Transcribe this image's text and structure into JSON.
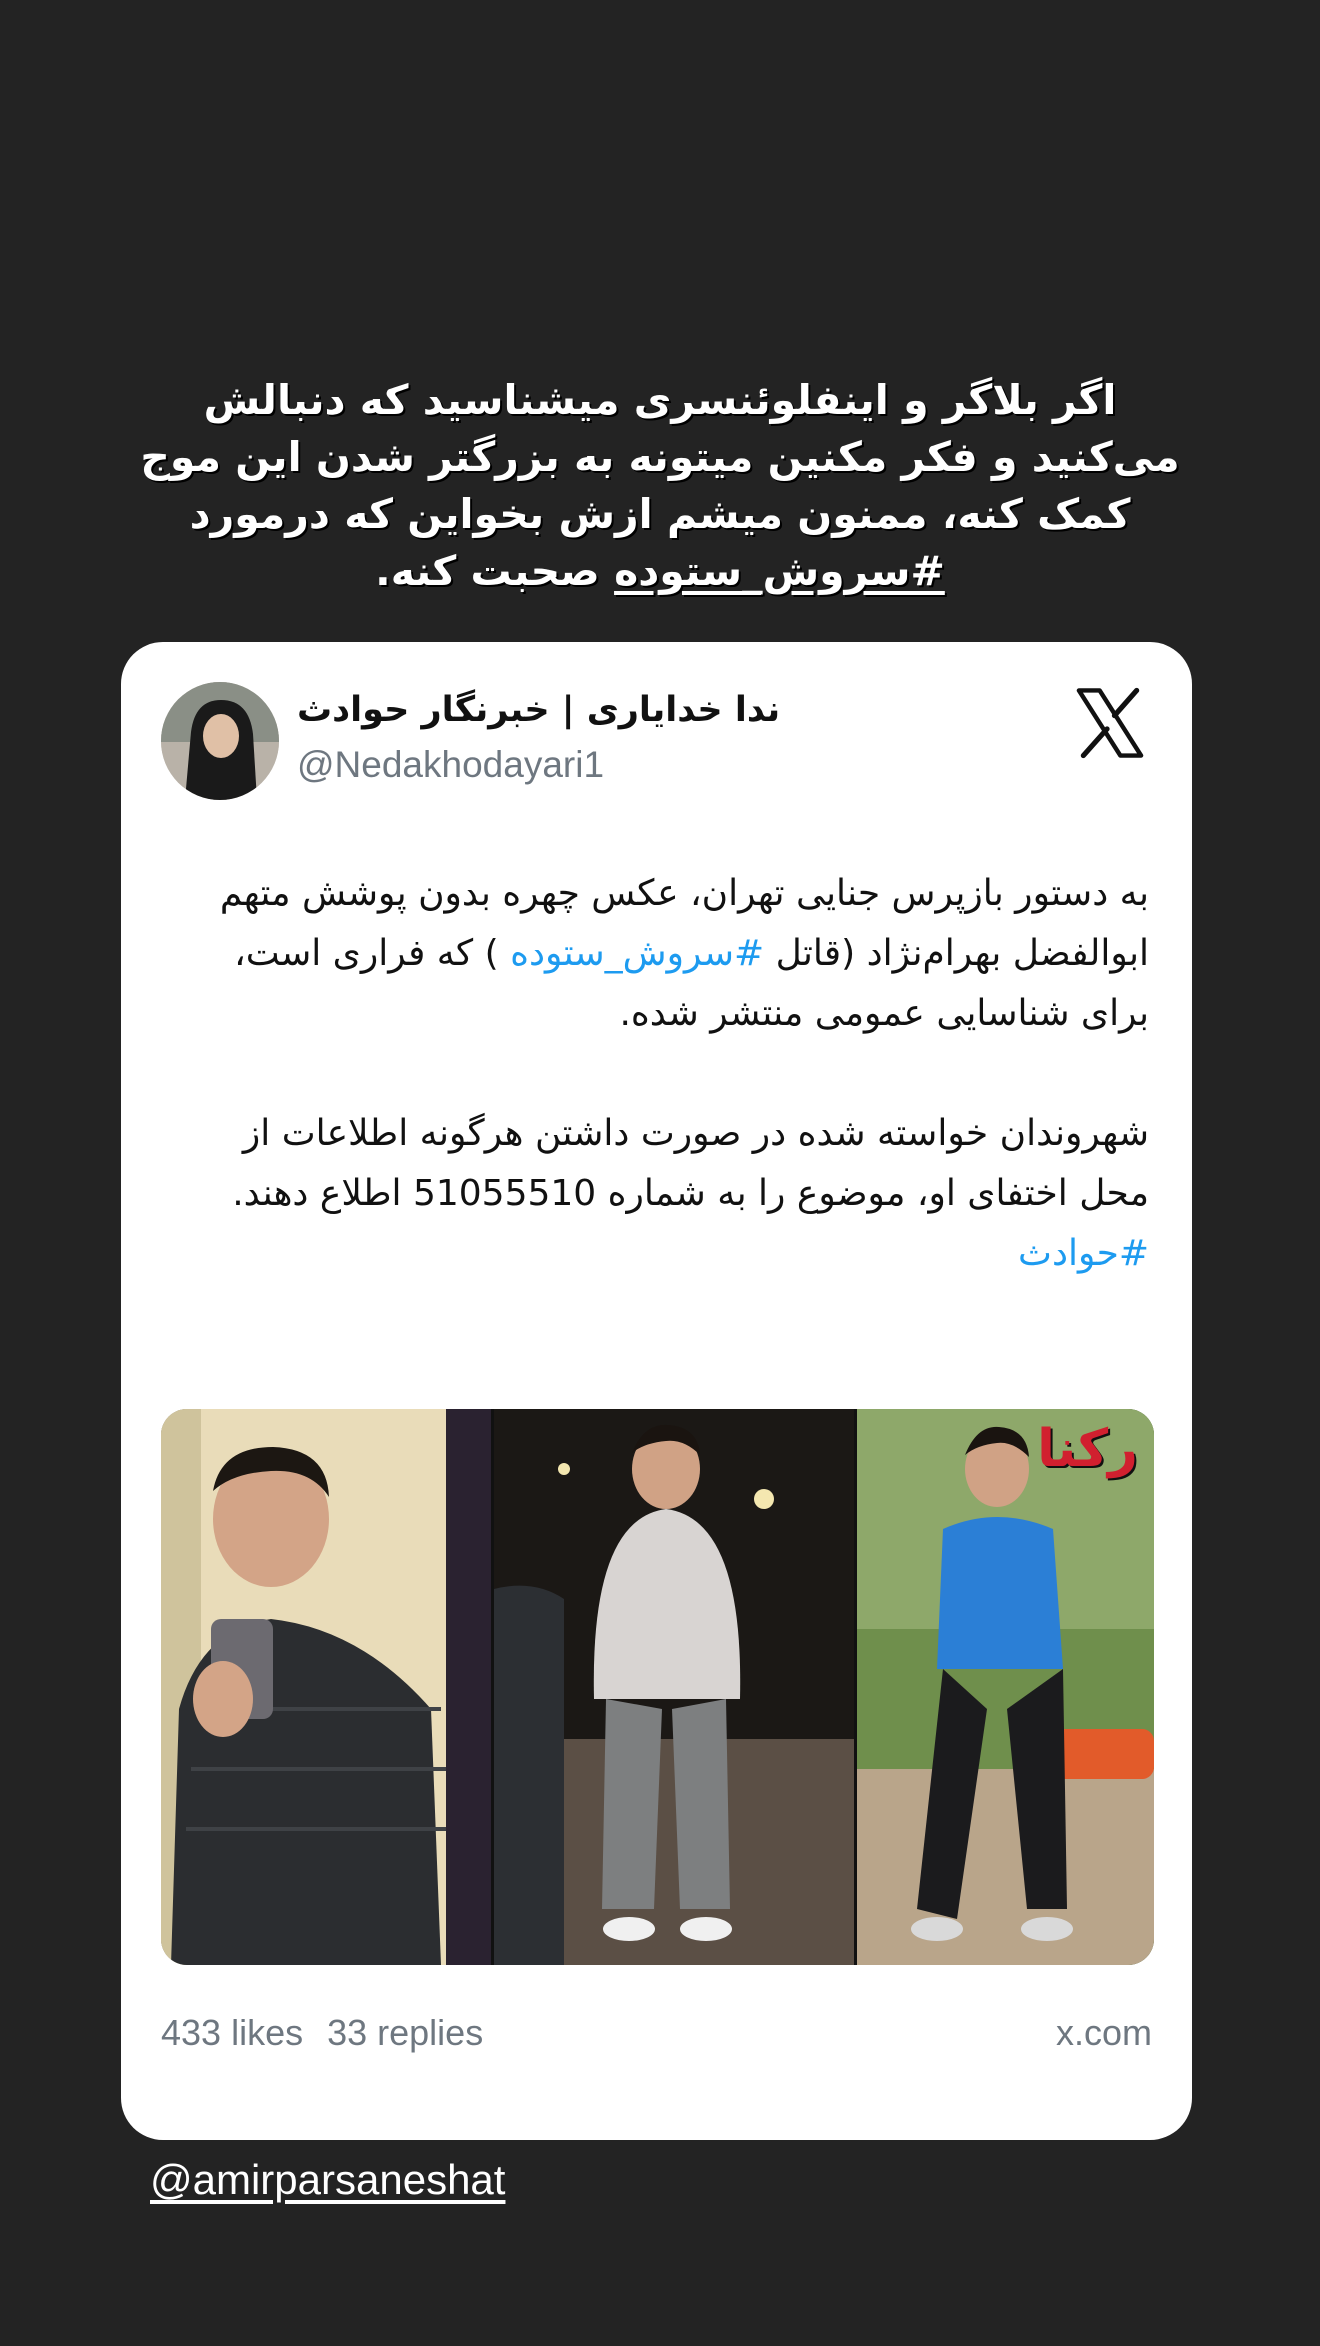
{
  "story": {
    "caption_text": "اگر بلاگر و اینفلوئنسری میشناسید که دنبالش می‌کنید و فکر مکنین میتونه به بزرگتر شدن این موج کمک کنه، ممنون میشم ازش بخواین که درمورد",
    "caption_hashtag": "#سروش_ستوده",
    "caption_end": "صحبت کنه.",
    "mention": "@amirparsaneshat"
  },
  "tweet": {
    "author_name": "ندا خدایاری | خبرنگار حوادث",
    "handle": "@Nedakhodayari1",
    "logo_icon": "x-logo-icon",
    "para1_before": "به دستور بازپرس جنایی تهران، عکس چهره بدون پوشش متهم ابوالفضل بهرام‌نژاد (قاتل",
    "para1_hashtag": "#سروش_ستوده",
    "para1_after": ") که فراری است، برای شناسایی عمومی منتشر شده.",
    "para2": "شهروندان خواسته شده در صورت داشتن هرگونه اطلاعات از محل اختفای او، موضوع را به شماره 51055510 اطلاع دهند.",
    "hashtag2": "#حوادث",
    "media_watermark": "رکنا",
    "likes": "433 likes",
    "replies": "33 replies",
    "domain": "x.com"
  },
  "colors": {
    "background": "#232323",
    "card": "#ffffff",
    "link": "#1d9bf0",
    "muted": "#6e7780"
  }
}
